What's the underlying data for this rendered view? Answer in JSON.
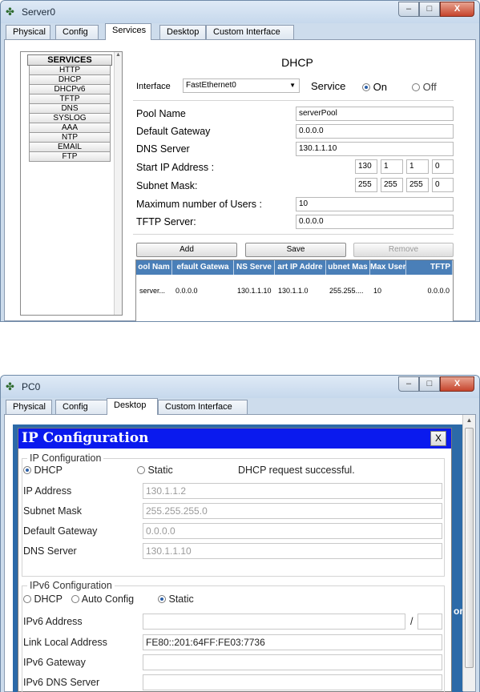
{
  "server_window": {
    "title": "Server0",
    "controls": {
      "minimize": "–",
      "maximize": "□",
      "close": "X"
    },
    "tabs": [
      "Physical",
      "Config",
      "Services",
      "Desktop",
      "Custom Interface"
    ],
    "active_tab": "Services",
    "services": {
      "header": "SERVICES",
      "items": [
        "HTTP",
        "DHCP",
        "DHCPv6",
        "TFTP",
        "DNS",
        "SYSLOG",
        "AAA",
        "NTP",
        "EMAIL",
        "FTP"
      ]
    },
    "dhcp": {
      "title": "DHCP",
      "interface_label": "Interface",
      "interface_value": "FastEthernet0",
      "service_label": "Service",
      "on_label": "On",
      "off_label": "Off",
      "pool_name_label": "Pool Name",
      "pool_name_value": "serverPool",
      "default_gateway_label": "Default Gateway",
      "default_gateway_value": "0.0.0.0",
      "dns_server_label": "DNS Server",
      "dns_server_value": "130.1.1.10",
      "start_ip_label": "Start IP Address :",
      "start_ip": [
        "130",
        "1",
        "1",
        "0"
      ],
      "subnet_mask_label": "Subnet Mask:",
      "subnet_mask": [
        "255",
        "255",
        "255",
        "0"
      ],
      "max_users_label": "Maximum number of Users :",
      "max_users_value": "10",
      "tftp_server_label": "TFTP Server:",
      "tftp_server_value": "0.0.0.0",
      "buttons": {
        "add": "Add",
        "save": "Save",
        "remove": "Remove"
      },
      "table": {
        "columns": [
          "ool Nam",
          "efault Gatewa",
          "NS Serve",
          "art IP Addre",
          "ubnet Mas",
          "Max User",
          "TFTP"
        ],
        "rows": [
          [
            "server...",
            "0.0.0.0",
            "130.1.1.10",
            "130.1.1.0",
            "255.255....",
            "10",
            "0.0.0.0"
          ]
        ]
      }
    }
  },
  "pc_window": {
    "title": "PC0",
    "controls": {
      "minimize": "–",
      "maximize": "□",
      "close": "X"
    },
    "tabs": [
      "Physical",
      "Config",
      "Desktop",
      "Custom Interface"
    ],
    "active_tab": "Desktop",
    "ip_config": {
      "title": "IP Configuration",
      "close_label": "X",
      "group_label": "IP Configuration",
      "dhcp_label": "DHCP",
      "static_label": "Static",
      "status": "DHCP request successful.",
      "ip_address_label": "IP Address",
      "ip_address_value": "130.1.1.2",
      "subnet_mask_label": "Subnet Mask",
      "subnet_mask_value": "255.255.255.0",
      "default_gateway_label": "Default Gateway",
      "default_gateway_value": "0.0.0.0",
      "dns_server_label": "DNS Server",
      "dns_server_value": "130.1.1.10",
      "ipv6_group_label": "IPv6 Configuration",
      "ipv6_dhcp_label": "DHCP",
      "ipv6_auto_label": "Auto Config",
      "ipv6_static_label": "Static",
      "ipv6_address_label": "IPv6 Address",
      "ipv6_address_value": "",
      "ipv6_prefix_sep": "/",
      "link_local_label": "Link Local Address",
      "link_local_value": "FE80::201:64FF:FE03:7736",
      "ipv6_gateway_label": "IPv6 Gateway",
      "ipv6_gateway_value": "",
      "ipv6_dns_label": "IPv6 DNS Server",
      "ipv6_dns_value": ""
    },
    "background_fragment": "or"
  }
}
